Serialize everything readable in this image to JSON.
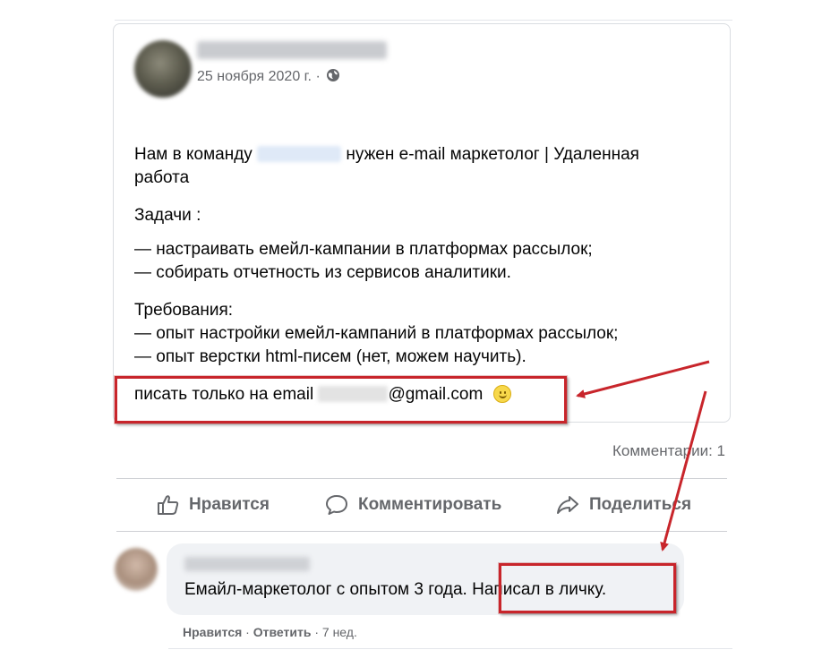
{
  "post": {
    "date": "25 ноября 2020 г. ·",
    "line1_before": "Нам в команду",
    "line1_after": "нужен e-mail маркетолог | Удаленная",
    "line2": "работа",
    "tasks_heading": "Задачи :",
    "task1": "— настраивать емейл-кампании в платформах рассылок;",
    "task2": "— собирать отчетность из сервисов аналитики.",
    "req_heading": "Требования:",
    "req1": "— опыт настройки емейл-кампаний в платформах рассылок;",
    "req2": "— опыт верстки html-писем (нет, можем научить).",
    "contact_before": "писать только на email",
    "contact_after": "@gmail.com"
  },
  "comments_count": "Комментарии: 1",
  "actions": {
    "like": "Нравится",
    "comment": "Комментировать",
    "share": "Поделиться"
  },
  "comment": {
    "text_part1": "Емайл-маркетолог с опытом 3 года.",
    "text_part2": "Написал в личку.",
    "like": "Нравится",
    "sep1": " · ",
    "reply": "Ответить",
    "time": " · 7 нед."
  },
  "colors": {
    "highlight": "#c8252b",
    "secondary_text": "#65676b",
    "comment_bubble": "#f0f2f5"
  }
}
